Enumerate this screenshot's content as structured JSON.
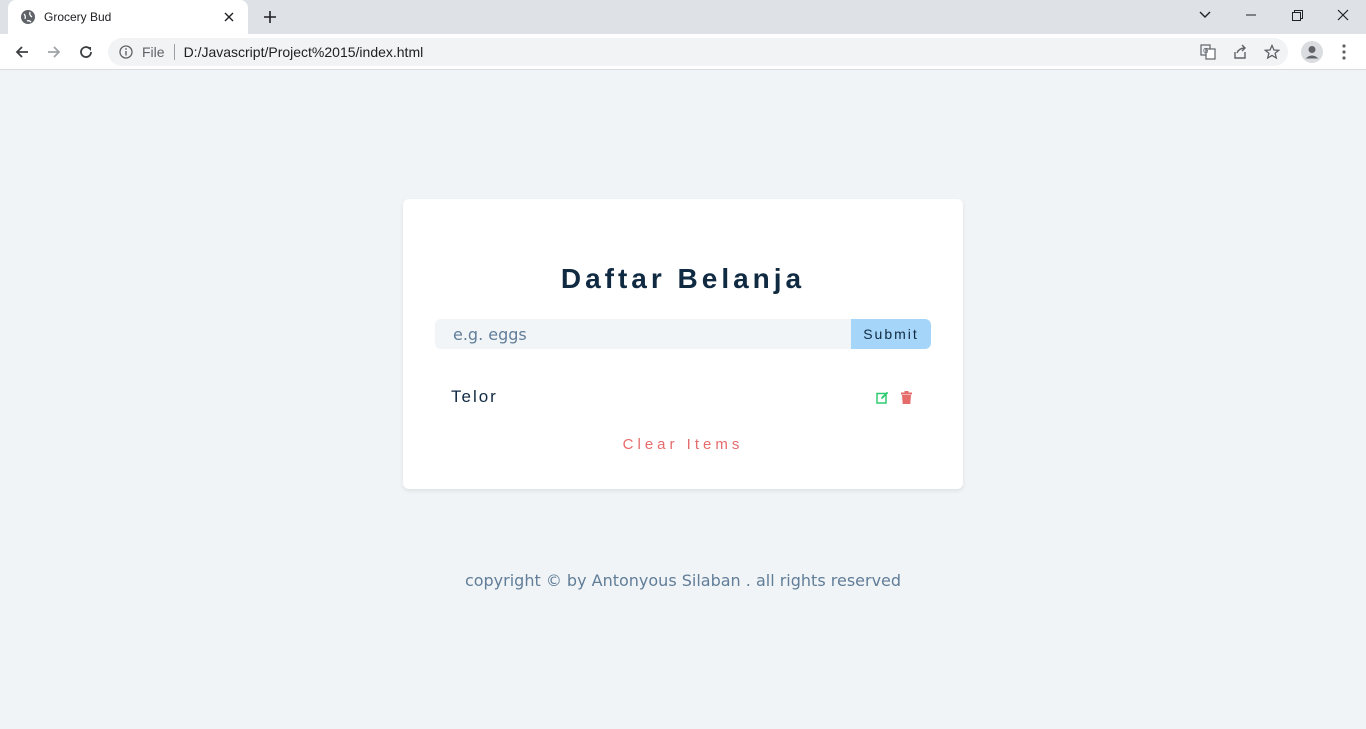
{
  "browser": {
    "tab_title": "Grocery Bud",
    "url_scheme": "File",
    "url": "D:/Javascript/Project%2015/index.html"
  },
  "app": {
    "title": "Daftar Belanja",
    "input_placeholder": "e.g. eggs",
    "submit_label": "Submit",
    "items": [
      {
        "title": "Telor"
      }
    ],
    "clear_label": "Clear Items"
  },
  "footer": {
    "text": "copyright © by Antonyous Silaban . all rights reserved"
  },
  "colors": {
    "title": "#102a42",
    "submit_bg": "#a5d5f8",
    "edit_icon": "#2ecc71",
    "delete_icon": "#e66b6b",
    "clear_text": "#e66b6b",
    "page_bg": "#f0f4f7"
  }
}
